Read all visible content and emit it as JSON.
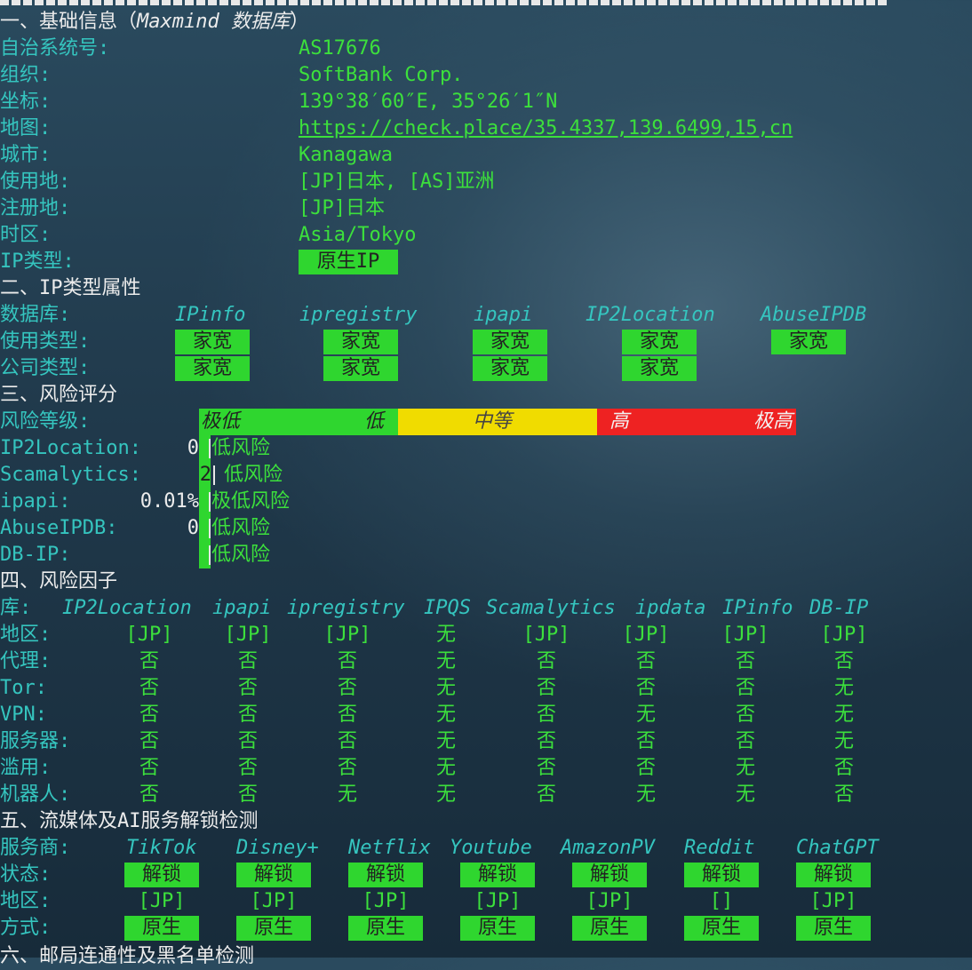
{
  "top_divider": "",
  "basic": {
    "header_prefix": "一、基础信息（",
    "header_db": "Maxmind 数据库",
    "header_suffix": "）",
    "rows": [
      {
        "label": "自治系统号:",
        "value": "AS17676"
      },
      {
        "label": "组织:",
        "value": "SoftBank Corp."
      },
      {
        "label": "坐标:",
        "value": "139°38′60″E, 35°26′1″N"
      },
      {
        "label": "地图:",
        "value": "https://check.place/35.4337,139.6499,15,cn"
      },
      {
        "label": "城市:",
        "value": "Kanagawa"
      },
      {
        "label": "使用地:",
        "value": "[JP]日本, [AS]亚洲"
      },
      {
        "label": "注册地:",
        "value": "[JP]日本"
      },
      {
        "label": "时区:",
        "value": "Asia/Tokyo"
      },
      {
        "label": "IP类型:",
        "value": "原生IP"
      }
    ]
  },
  "ip_type": {
    "header": "二、IP类型属性",
    "db_label": "数据库:",
    "databases": [
      "IPinfo",
      "ipregistry",
      "ipapi",
      "IP2Location",
      "AbuseIPDB"
    ],
    "usage_label": "使用类型:",
    "usage": [
      "家宽",
      "家宽",
      "家宽",
      "家宽",
      "家宽"
    ],
    "company_label": "公司类型:",
    "company": [
      "家宽",
      "家宽",
      "家宽",
      "家宽"
    ]
  },
  "risk_score": {
    "header": "三、风险评分",
    "level_label": "风险等级:",
    "scale": [
      "极低",
      "低",
      "中等",
      "高",
      "极高"
    ],
    "scale_colors": {
      "low": "#2fd62f",
      "mid": "#f0dc00",
      "high": "#ee2222"
    },
    "rows": [
      {
        "label": "IP2Location:",
        "score": "0",
        "text": "低风险"
      },
      {
        "label": "Scamalytics:",
        "score": "2",
        "text": "低风险"
      },
      {
        "label": "ipapi:",
        "score": "0.01%",
        "text": "极低风险"
      },
      {
        "label": "AbuseIPDB:",
        "score": "0",
        "text": "低风险"
      },
      {
        "label": "DB-IP:",
        "score": "",
        "text": "低风险"
      }
    ]
  },
  "risk_factors": {
    "header": "四、风险因子",
    "lib_label": "库:",
    "libs": [
      "IP2Location",
      "ipapi",
      "ipregistry",
      "IPQS",
      "Scamalytics",
      "ipdata",
      "IPinfo",
      "DB-IP"
    ],
    "rows": [
      {
        "label": "地区:",
        "values": [
          "[JP]",
          "[JP]",
          "[JP]",
          "无",
          "[JP]",
          "[JP]",
          "[JP]",
          "[JP]"
        ]
      },
      {
        "label": "代理:",
        "values": [
          "否",
          "否",
          "否",
          "无",
          "否",
          "否",
          "否",
          "否"
        ]
      },
      {
        "label": "Tor:",
        "values": [
          "否",
          "否",
          "否",
          "无",
          "否",
          "否",
          "否",
          "无"
        ]
      },
      {
        "label": "VPN:",
        "values": [
          "否",
          "否",
          "否",
          "无",
          "否",
          "无",
          "否",
          "无"
        ]
      },
      {
        "label": "服务器:",
        "values": [
          "否",
          "否",
          "否",
          "无",
          "否",
          "否",
          "否",
          "无"
        ]
      },
      {
        "label": "滥用:",
        "values": [
          "否",
          "否",
          "否",
          "无",
          "否",
          "否",
          "无",
          "否"
        ]
      },
      {
        "label": "机器人:",
        "values": [
          "否",
          "否",
          "无",
          "无",
          "否",
          "无",
          "无",
          "否"
        ]
      }
    ]
  },
  "streaming": {
    "header": "五、流媒体及AI服务解锁检测",
    "provider_label": "服务商:",
    "providers": [
      "TikTok",
      "Disney+",
      "Netflix",
      "Youtube",
      "AmazonPV",
      "Reddit",
      "ChatGPT"
    ],
    "status_label": "状态:",
    "status": [
      "解锁",
      "解锁",
      "解锁",
      "解锁",
      "解锁",
      "解锁",
      "解锁"
    ],
    "region_label": "地区:",
    "region": [
      "[JP]",
      "[JP]",
      "[JP]",
      "[JP]",
      "[JP]",
      "[]",
      "[JP]"
    ],
    "method_label": "方式:",
    "method": [
      "原生",
      "原生",
      "原生",
      "原生",
      "原生",
      "原生",
      "原生"
    ]
  },
  "next_section": {
    "header": "六、邮局连通性及黑名单检测"
  }
}
